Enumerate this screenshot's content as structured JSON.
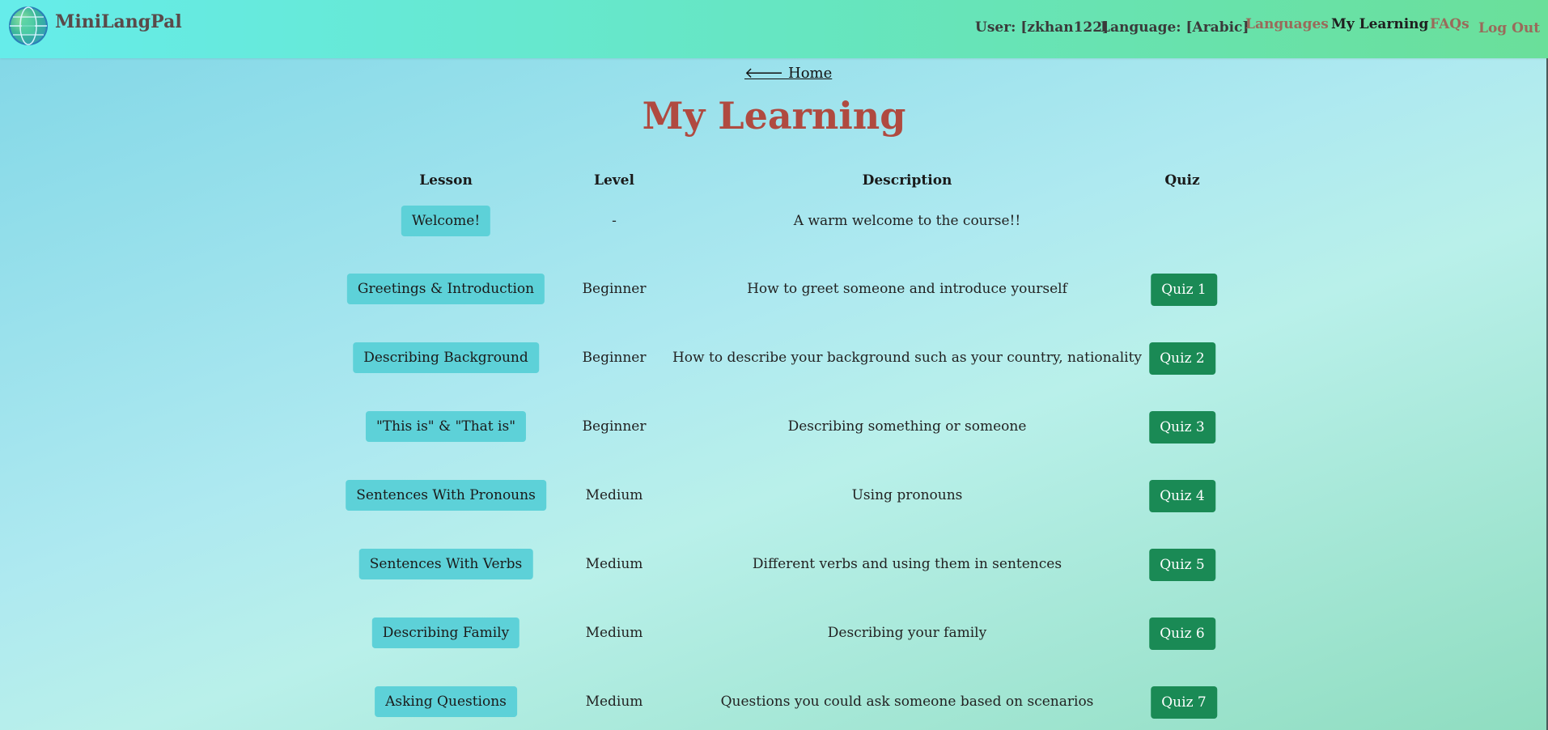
{
  "header": {
    "brand": "MiniLangPal",
    "user": "User: [zkhan122]",
    "language": "Language: [Arabic]",
    "nav": [
      {
        "label": "Languages"
      },
      {
        "label": "My Learning"
      },
      {
        "label": "FAQs"
      },
      {
        "label": "Log Out"
      }
    ]
  },
  "home_link": "🡐 Home",
  "title": "My Learning",
  "columns": [
    "Lesson",
    "Level",
    "Description",
    "Quiz"
  ],
  "rows": [
    {
      "lesson": "Welcome!",
      "level": "-",
      "description": "A warm welcome to the course!!",
      "quiz": ""
    },
    {
      "lesson": "Greetings & Introduction",
      "level": "Beginner",
      "description": "How to greet someone and introduce yourself",
      "quiz": "Quiz 1"
    },
    {
      "lesson": "Describing Background",
      "level": "Beginner",
      "description": "How to describe your background such as your country, nationality",
      "quiz": "Quiz 2"
    },
    {
      "lesson": "\"This is\" & \"That is\"",
      "level": "Beginner",
      "description": "Describing something or someone",
      "quiz": "Quiz 3"
    },
    {
      "lesson": "Sentences With Pronouns",
      "level": "Medium",
      "description": "Using pronouns",
      "quiz": "Quiz 4"
    },
    {
      "lesson": "Sentences With Verbs",
      "level": "Medium",
      "description": "Different verbs and using them in sentences",
      "quiz": "Quiz 5"
    },
    {
      "lesson": "Describing Family",
      "level": "Medium",
      "description": "Describing your family",
      "quiz": "Quiz 6"
    },
    {
      "lesson": "Asking Questions",
      "level": "Medium",
      "description": "Questions you could ask someone based on scenarios",
      "quiz": "Quiz 7"
    }
  ]
}
